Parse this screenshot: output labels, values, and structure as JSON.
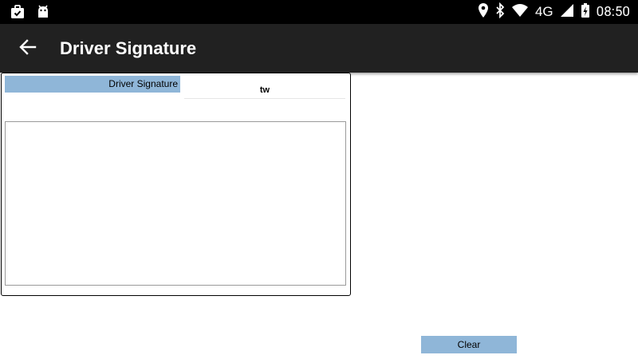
{
  "status_bar": {
    "network": "4G",
    "time": "08:50",
    "icons": [
      "briefcase-check-icon",
      "android-icon",
      "location-icon",
      "bluetooth-icon",
      "wifi-icon",
      "signal-icon",
      "battery-charging-icon"
    ]
  },
  "app_bar": {
    "title": "Driver Signature",
    "back_icon": "arrow-back-icon"
  },
  "signature_panel": {
    "header": "Driver Signature",
    "driver_name": "tw"
  },
  "actions": {
    "clear_label": "Clear"
  },
  "colors": {
    "status_bar": "#000000",
    "app_bar": "#212121",
    "accent_blue": "#8fb6d8"
  }
}
